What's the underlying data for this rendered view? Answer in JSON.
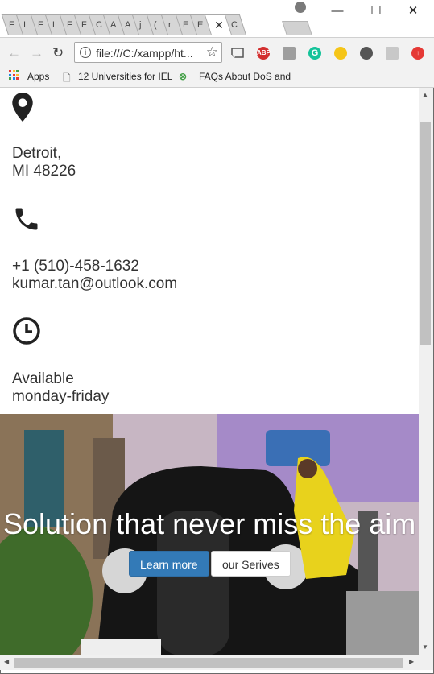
{
  "browser": {
    "tabs": [
      "F",
      "I",
      "F",
      "L",
      "F",
      "F",
      "C",
      "A",
      "A",
      "j",
      "(",
      "r",
      "E",
      "E"
    ],
    "active_tab_icon": "✕",
    "active_tab_next": "C",
    "window_controls": {
      "minimize": "—",
      "maximize": "☐",
      "close": "✕"
    },
    "url": "file:///C:/xampp/ht...",
    "bookmarks": {
      "apps": "Apps",
      "item1": "12 Universities for IEL",
      "item2": "FAQs About DoS and"
    },
    "extensions": [
      {
        "name": "cast-icon"
      },
      {
        "name": "adblock-icon",
        "label": "ABP",
        "color": "#d32f2f"
      },
      {
        "name": "drive-icon",
        "color": "#9e9e9e"
      },
      {
        "name": "grammarly-icon",
        "label": "G",
        "color": "#15c39a"
      },
      {
        "name": "extension-icon",
        "color": "#f5c518"
      },
      {
        "name": "film-icon",
        "color": "#555555"
      },
      {
        "name": "reader-icon",
        "color": "#c8c8c8"
      },
      {
        "name": "upload-icon",
        "color": "#e53935"
      }
    ]
  },
  "contact": {
    "address_line1": "Detroit,",
    "address_line2": "MI 48226",
    "phone": "+1 (510)-458-1632",
    "email": "kumar.tan@outlook.com",
    "hours_line1": "Available",
    "hours_line2": "monday-friday"
  },
  "hero": {
    "heading": "Solution that never miss the aim",
    "primary_button": "Learn more",
    "secondary_button": "our Serives"
  },
  "colors": {
    "primary": "#337ab7",
    "text": "#333333"
  }
}
